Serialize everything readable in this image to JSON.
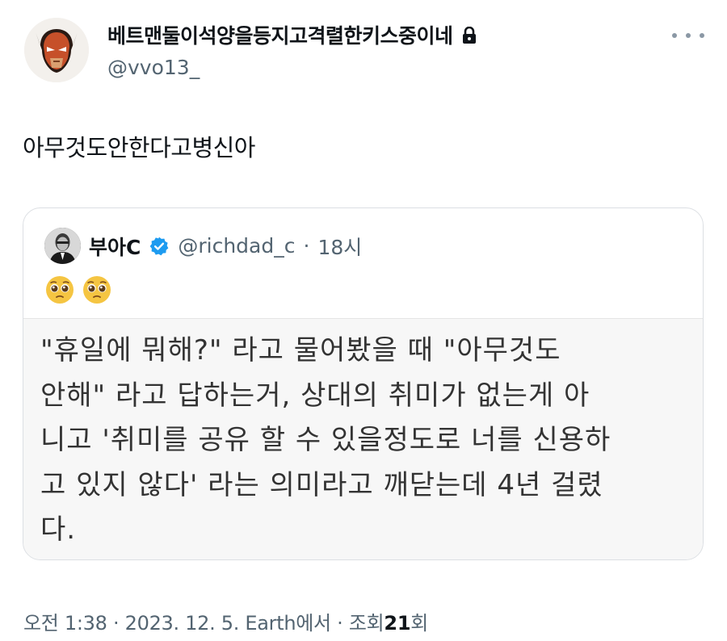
{
  "author": {
    "display_name": "베트맨둘이석양을등지고격렬한키스중이네",
    "handle": "@vvo13_",
    "avatar_icon": "wolverine-mask-avatar",
    "protected_icon": "lock-icon"
  },
  "tweet": {
    "text": "아무것도안한다고병신아"
  },
  "quote": {
    "display_name": "부아C",
    "verified_icon": "verified-badge-icon",
    "handle": "@richdad_c",
    "separator": "·",
    "time": "18시",
    "emojis": [
      "pleading-face",
      "pleading-face"
    ],
    "image_text_lines": [
      "\"휴일에 뭐해?\" 라고 물어봤을 때 \"아무것도",
      "안해\" 라고 답하는거, 상대의 취미가 없는게 아",
      "니고 '취미를 공유 할 수 있을정도로 너를 신용하",
      "고 있지 않다' 라는 의미라고 깨닫는데 4년 걸렸",
      "다."
    ]
  },
  "meta": {
    "time": "오전 1:38",
    "separator1": "·",
    "date": "2023. 12. 5.",
    "source": "Earth에서",
    "separator2": "·",
    "views_label": "조회",
    "views_count": "21",
    "views_suffix": "회"
  },
  "colors": {
    "text": "#0f1419",
    "secondary": "#536471",
    "verified": "#1d9bf0",
    "border": "#dcdfe3"
  }
}
